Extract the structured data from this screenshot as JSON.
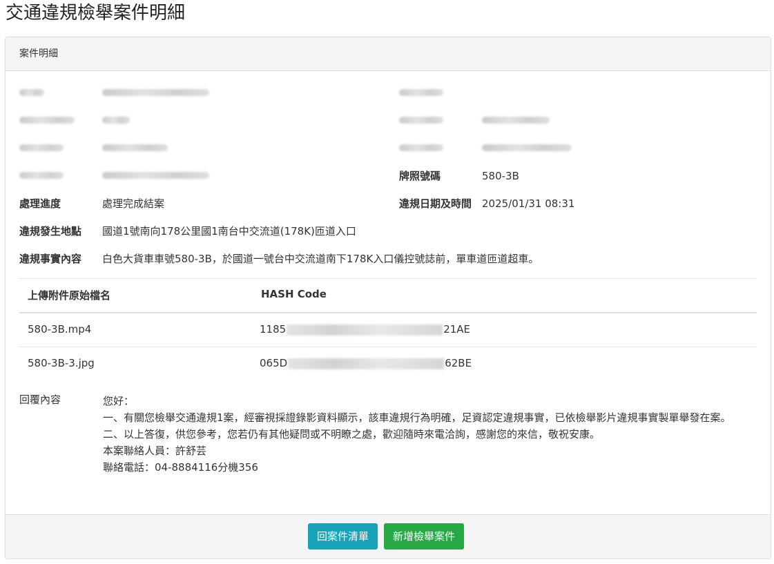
{
  "page": {
    "title": "交通違規檢舉案件明細"
  },
  "panel": {
    "heading": "案件明細"
  },
  "fields": {
    "plate_label": "牌照號碼",
    "plate_value": "580-3B",
    "progress_label": "處理進度",
    "progress_value": "處理完成結案",
    "datetime_label": "違規日期及時間",
    "datetime_value": "2025/01/31 08:31",
    "location_label": "違規發生地點",
    "location_value": "國道1號南向178公里國1南台中交流道(178K)匝道入口",
    "facts_label": "違規事實內容",
    "facts_value": "白色大貨車車號580-3B，於國道一號台中交流道南下178K入口儀控號誌前，單車道匝道超車。"
  },
  "attachments": {
    "col_name": "上傳附件原始檔名",
    "col_hash": "HASH Code",
    "rows": [
      {
        "name": "580-3B.mp4",
        "hash_start": "1185",
        "hash_end": "21AE"
      },
      {
        "name": "580-3B-3.jpg",
        "hash_start": "065D",
        "hash_end": "62BE"
      }
    ]
  },
  "reply": {
    "label": "回覆內容",
    "lines": [
      "您好：",
      "一、有關您檢舉交通違規1案，經審視採證錄影資料顯示，該車違規行為明確，足資認定違規事實，已依檢舉影片違規事實製單舉發在案。",
      "二、以上答復，供您參考，您若仍有其他疑問或不明瞭之處，歡迎隨時來電洽詢，感謝您的來信，敬祝安康。",
      "本案聯絡人員：許舒芸",
      "聯絡電話：04-8884116分機356"
    ]
  },
  "buttons": {
    "back_label": "回案件清單",
    "new_label": "新增檢舉案件"
  },
  "colors": {
    "back_button": "#17a2b8",
    "new_button": "#28a745"
  }
}
